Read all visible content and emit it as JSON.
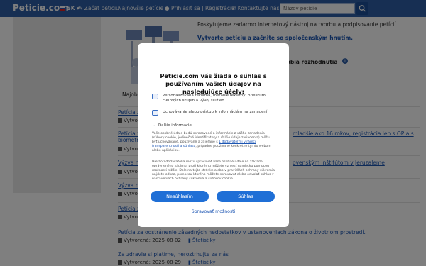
{
  "nav": {
    "brand": "Peticie.com",
    "lang": "SK",
    "start": "Začať petíciu",
    "newest": "Najnovšie petície",
    "login": "Prihlásiť sa | Registrácia",
    "contact": "Kontaktujte nás",
    "search_placeholder": "Názov peticie"
  },
  "intro": {
    "text": "Poskytujeme zadarmo internetový nástroj na tvorbu a podpisovanie petícií.",
    "link": "Vytvorte petíciu a začnite so spoločenským hnutím.",
    "decide": "robia rozhodnutia",
    "najob": "Najob"
  },
  "petitions": [
    {
      "title": "Petícia z",
      "meta": "Vytvorené:",
      "stat": ""
    },
    {
      "title": "Petícia z",
      "title_tail": "mladšie ako 16 rokov, registrácia len s OP a s",
      "title2": "biometr",
      "meta": "Vytvore",
      "stat": ""
    },
    {
      "title": "Výzva na",
      "title_tail": "ovenským inštitútom v Jeruzaleme",
      "meta": "Vytvore",
      "stat": ""
    },
    {
      "title": "Výzva na",
      "meta": "Vytvore",
      "stat": ""
    },
    {
      "title": "Petícia z",
      "meta": "Vytvore",
      "stat": ""
    },
    {
      "title": "Petícia za odstránenie zásadných nedostatkov v ustanoveniach zákona o životnom prostredí.",
      "meta": "Vytvorené: 2025-08-02",
      "stat": "Štatistiky"
    },
    {
      "title": "Za zdravie si platíme, neroztrhujte za nás",
      "meta": "Vytvorené: 2025-08-29",
      "stat": "Štatistiky"
    }
  ],
  "consent": {
    "title": "Peticie.com vás žiada o súhlas s používaním vašich údajov na nasledujúce účely:",
    "item1": "Personalizovaná reklama, meranie reklamy, prieskum cieľových skupín a vývoj služieb",
    "item2": "Uchovávanie alebo prístup k informáciám na zariadení",
    "more": "Ďalšie informácie",
    "para1_a": "Vaše osobné údaje budú spracované a informácie z vášho zariadenia (súbory cookie, jedinečné identifikátory a ďalšie údaje zariadenia) môžu byť uchovávané, používané a zdieľané s",
    "para1_link1": "1 dodávateľmi v rámci transparentnosti a súhlasu",
    "para1_b": ", prípadne používané konkrétne týmto webom alebo aplikáciou.",
    "para2": "Niektorí dodávatelia môžu spracúvať vaše osobné údaje na základe oprávneného záujmu, proti ktorému môžete vzniesť námietku pomocou možnosti nižšie. Dole na tejto stránke alebo v pravidlách ochrany súkromia nájdete odkaz, pomocou ktorého môžete spravovať alebo odvolať súhlas v nastaveniach ochrany súkromia a súborov cookie.",
    "reject": "Nesúhlasím",
    "accept": "Súhlas",
    "manage": "Spravovať možnosti"
  },
  "colors": {
    "nav_bg": "#2f5fa6",
    "accent": "#1f6fd6",
    "link": "#1d56b3"
  }
}
